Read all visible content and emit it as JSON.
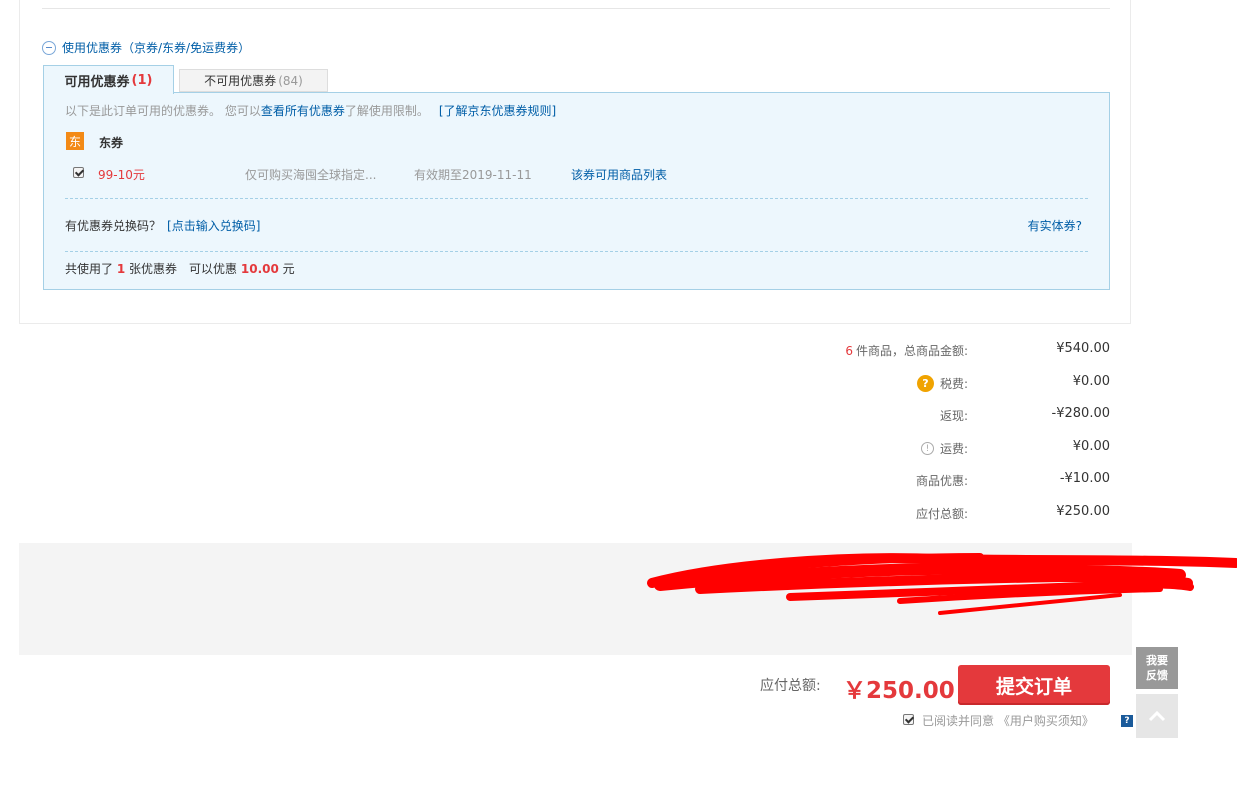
{
  "coupons": {
    "section_title": "使用优惠券（京券/东券/免运费券）",
    "tabs": {
      "available_label": "可用优惠券",
      "available_count": "(1)",
      "unavailable_label": "不可用优惠券",
      "unavailable_count": "(84)"
    },
    "hint_prefix": "以下是此订单可用的优惠券。 您可以",
    "hint_link": "查看所有优惠券",
    "hint_suffix": "了解使用限制。",
    "rules_link": "[了解京东优惠券规则]",
    "type_badge": "东",
    "type_name": "东券",
    "items": [
      {
        "amount": "99-10元",
        "scope": "仅可购买海囤全球指定...",
        "expire": "有效期至2019-11-11",
        "product_link": "该券可用商品列表",
        "checked": true
      }
    ],
    "redeem_prefix": "有优惠券兑换码？",
    "redeem_link": "[点击输入兑换码]",
    "physical_link": "有实体券?",
    "summary_prefix": "共使用了",
    "summary_count": "1",
    "summary_mid": "张优惠券　可以优惠",
    "summary_amount": "10.00",
    "summary_unit": "元"
  },
  "order_summary": {
    "items_count": "6",
    "rows": [
      {
        "label": "件商品，总商品金额:",
        "value": "¥540.00"
      },
      {
        "label": "税费:",
        "value": "¥0.00",
        "icon": "question-icon"
      },
      {
        "label": "返现:",
        "value": "-¥280.00"
      },
      {
        "label": "运费:",
        "value": "¥0.00",
        "icon": "info-icon"
      },
      {
        "label": "商品优惠:",
        "value": "-¥10.00"
      },
      {
        "label": "应付总额:",
        "value": "¥250.00"
      }
    ]
  },
  "footer": {
    "total_label": "应付总额:",
    "total_value": "￥250.00",
    "submit_label": "提交订单",
    "agree_text": "已阅读并同意 《用户购买须知》",
    "help_badge": "?"
  },
  "side_tools": {
    "feedback_line1": "我要",
    "feedback_line2": "反馈"
  },
  "colors": {
    "accent_red": "#e4393c",
    "link_blue": "#005ea7",
    "coupon_bg": "#edf7fd",
    "coupon_border": "#a5d0e6",
    "badge_orange": "#f38a16",
    "redaction": "#ff0000"
  }
}
